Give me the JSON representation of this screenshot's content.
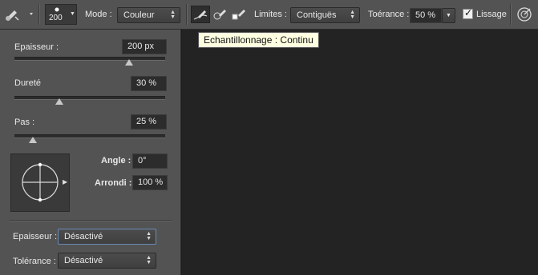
{
  "toolbar": {
    "brush_size": "200",
    "mode_label": "Mode :",
    "mode_value": "Couleur",
    "limits_label": "Limites :",
    "limits_value": "Contiguës",
    "tolerance_label": "Toérance :",
    "tolerance_value": "50 %",
    "smoothing_label": "Lissage",
    "smoothing_checked": true
  },
  "tooltip": "Echantillonnage : Continu",
  "panel": {
    "thickness_label": "Epaisseur :",
    "thickness_value": "200 px",
    "thickness_level": 0.76,
    "hardness_label": "Dureté",
    "hardness_value": "30 %",
    "hardness_level": 0.3,
    "spacing_label": "Pas :",
    "spacing_value": "25 %",
    "spacing_level": 0.12,
    "angle_label": "Angle :",
    "angle_value": "0°",
    "roundness_label": "Arrondi :",
    "roundness_value": "100 %",
    "pen_thickness_label": "Epaisseur :",
    "pen_thickness_value": "Désactivé",
    "pen_tolerance_label": "Tolérance :",
    "pen_tolerance_value": "Désactivé"
  }
}
